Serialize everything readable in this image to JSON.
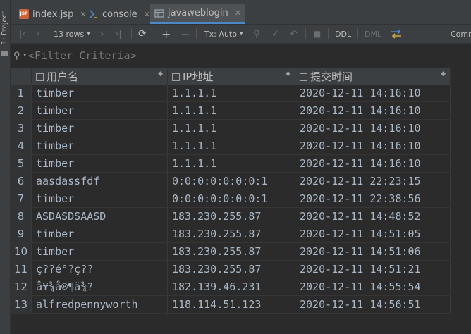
{
  "side": {
    "project_tab": "1: Project"
  },
  "tabs": [
    {
      "label": "index.jsp",
      "icon": "jsp-file-icon",
      "active": false
    },
    {
      "label": "console",
      "icon": "console-icon",
      "active": false
    },
    {
      "label": "javaweblogin",
      "icon": "table-icon",
      "active": true
    }
  ],
  "toolbar": {
    "rows_label": "13 rows",
    "tx_label": "Tx: Auto",
    "ddl_label": "DDL",
    "dml_label": "DML",
    "comm_label": "Comm"
  },
  "filter": {
    "placeholder": "<Filter Criteria>"
  },
  "grid": {
    "columns": [
      "用户名",
      "IP地址",
      "提交时间"
    ],
    "rows": [
      {
        "n": "1",
        "user": "timber",
        "ip": "1.1.1.1",
        "time": "2020-12-11 14:16:10"
      },
      {
        "n": "2",
        "user": "timber",
        "ip": "1.1.1.1",
        "time": "2020-12-11 14:16:10"
      },
      {
        "n": "3",
        "user": "timber",
        "ip": "1.1.1.1",
        "time": "2020-12-11 14:16:10"
      },
      {
        "n": "4",
        "user": "timber",
        "ip": "1.1.1.1",
        "time": "2020-12-11 14:16:10"
      },
      {
        "n": "5",
        "user": "timber",
        "ip": "1.1.1.1",
        "time": "2020-12-11 14:16:10"
      },
      {
        "n": "6",
        "user": "aasdassfdf",
        "ip": "0:0:0:0:0:0:0:1",
        "time": "2020-12-11 22:23:15"
      },
      {
        "n": "7",
        "user": "timber",
        "ip": "0:0:0:0:0:0:0:1",
        "time": "2020-12-11 22:38:56"
      },
      {
        "n": "8",
        "user": "ASDASDSAASD",
        "ip": "183.230.255.87",
        "time": "2020-12-11 14:48:52"
      },
      {
        "n": "9",
        "user": "timber",
        "ip": "183.230.255.87",
        "time": "2020-12-11 14:51:05"
      },
      {
        "n": "10",
        "user": "timber",
        "ip": "183.230.255.87",
        "time": "2020-12-11 14:51:06"
      },
      {
        "n": "11",
        "user": "ç??é°?ç??",
        "ip": "183.230.255.87",
        "time": "2020-12-11 14:51:21"
      },
      {
        "n": "12",
        "user": "å¥¾å®¶ä¾?",
        "ip": "182.139.46.231",
        "time": "2020-12-11 14:55:54"
      },
      {
        "n": "13",
        "user": "alfredpennyworth",
        "ip": "118.114.51.123",
        "time": "2020-12-11 14:56:51"
      }
    ]
  },
  "colors": {
    "accent": "#4a88c7",
    "background": "#2b2b2b",
    "panel": "#3c3f41",
    "text": "#a9b7c6"
  }
}
